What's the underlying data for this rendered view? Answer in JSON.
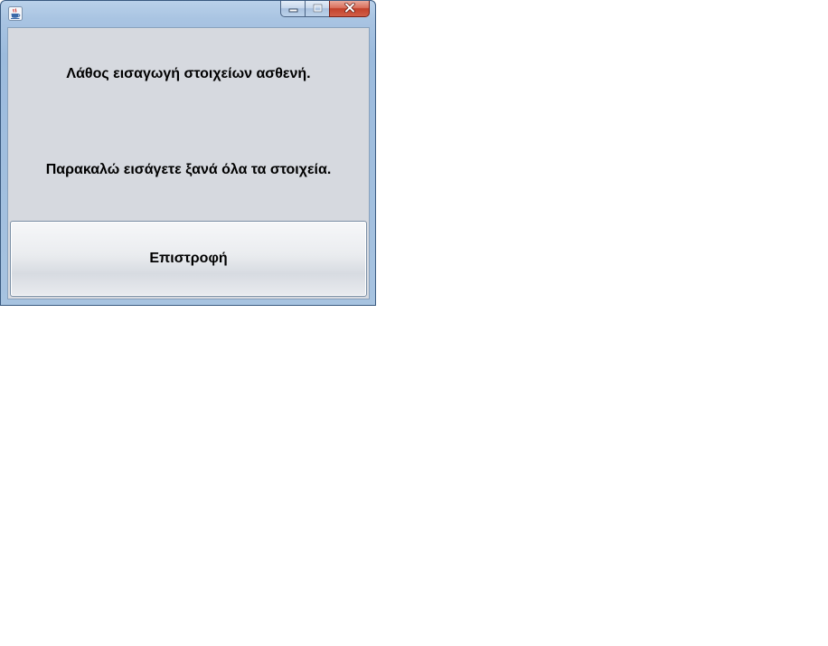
{
  "window": {
    "title": "",
    "icon": "java-coffee-cup-icon",
    "caption_buttons": [
      "minimize-icon",
      "maximize-icon",
      "close-icon"
    ]
  },
  "dialog": {
    "message_line1": "Λάθος εισαγωγή στοιχείων ασθενή.",
    "message_line2": "Παρακαλώ εισάγετε ξανά όλα τα στοιχεία.",
    "return_button_label": "Επιστροφή"
  }
}
